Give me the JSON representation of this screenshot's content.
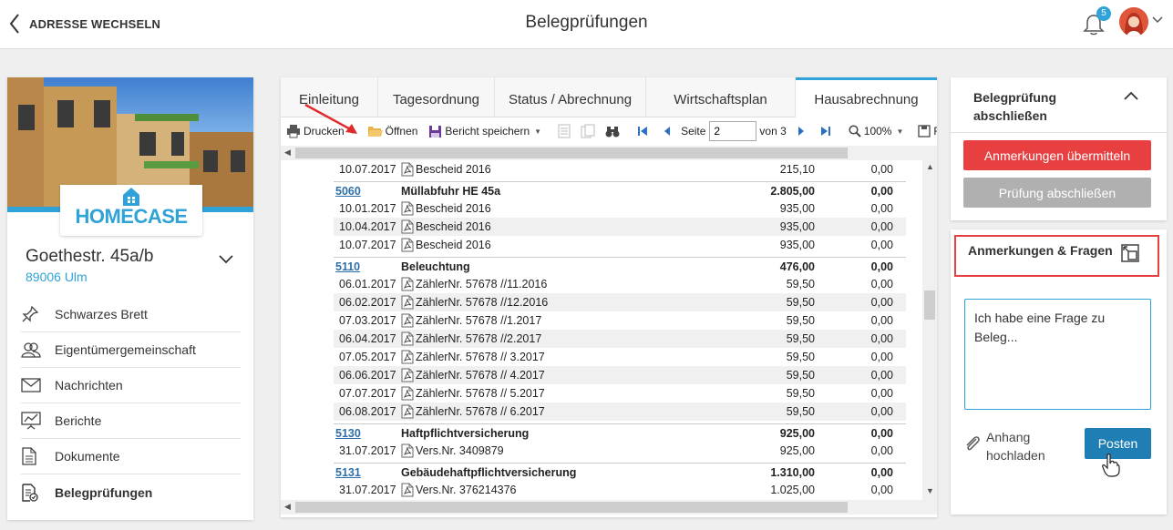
{
  "header": {
    "back_label": "ADRESSE WECHSELN",
    "title": "Belegprüfungen",
    "notification_count": "5"
  },
  "property": {
    "logo_text": "HOMECASE",
    "address": "Goethestr. 45a/b",
    "city": "89006 Ulm"
  },
  "nav": [
    {
      "label": "Schwarzes Brett",
      "icon": "pin-icon"
    },
    {
      "label": "Eigentümergemeinschaft",
      "icon": "users-icon"
    },
    {
      "label": "Nachrichten",
      "icon": "envelope-icon"
    },
    {
      "label": "Berichte",
      "icon": "chart-icon"
    },
    {
      "label": "Dokumente",
      "icon": "document-icon"
    },
    {
      "label": "Belegprüfungen",
      "icon": "receipt-check-icon",
      "active": true
    }
  ],
  "tabs": [
    "Einleitung",
    "Tagesordnung",
    "Status / Abrechnung",
    "Wirtschaftsplan",
    "Hausabrechnung"
  ],
  "active_tab": "Hausabrechnung",
  "toolbar": {
    "print": "Drucken",
    "open": "Öffnen",
    "save_report": "Bericht speichern",
    "page_label": "Seite",
    "page_value": "2",
    "page_of": "von 3",
    "zoom": "100%",
    "cut_label": "Fo"
  },
  "report_rows": [
    {
      "type": "item",
      "date": "10.07.2017",
      "desc": "Bescheid 2016",
      "amount": "215,10",
      "open": "0,00"
    },
    {
      "type": "group",
      "code": "5060",
      "desc": "Müllabfuhr HE 45a",
      "amount": "2.805,00",
      "open": "0,00"
    },
    {
      "type": "item",
      "date": "10.01.2017",
      "desc": "Bescheid 2016",
      "amount": "935,00",
      "open": "0,00"
    },
    {
      "type": "item",
      "date": "10.04.2017",
      "desc": "Bescheid 2016",
      "amount": "935,00",
      "open": "0,00"
    },
    {
      "type": "item",
      "date": "10.07.2017",
      "desc": "Bescheid 2016",
      "amount": "935,00",
      "open": "0,00"
    },
    {
      "type": "group",
      "code": "5110",
      "desc": "Beleuchtung",
      "amount": "476,00",
      "open": "0,00"
    },
    {
      "type": "item",
      "date": "06.01.2017",
      "desc": "ZählerNr. 57678 //11.2016",
      "amount": "59,50",
      "open": "0,00"
    },
    {
      "type": "item",
      "date": "06.02.2017",
      "desc": "ZählerNr. 57678 //12.2016",
      "amount": "59,50",
      "open": "0,00"
    },
    {
      "type": "item",
      "date": "07.03.2017",
      "desc": "ZählerNr. 57678 //1.2017",
      "amount": "59,50",
      "open": "0,00"
    },
    {
      "type": "item",
      "date": "06.04.2017",
      "desc": "ZählerNr. 57678 //2.2017",
      "amount": "59,50",
      "open": "0,00"
    },
    {
      "type": "item",
      "date": "07.05.2017",
      "desc": "ZählerNr. 57678 // 3.2017",
      "amount": "59,50",
      "open": "0,00"
    },
    {
      "type": "item",
      "date": "06.06.2017",
      "desc": "ZählerNr. 57678 // 4.2017",
      "amount": "59,50",
      "open": "0,00"
    },
    {
      "type": "item",
      "date": "07.07.2017",
      "desc": "ZählerNr. 57678 // 5.2017",
      "amount": "59,50",
      "open": "0,00"
    },
    {
      "type": "item",
      "date": "06.08.2017",
      "desc": "ZählerNr. 57678 // 6.2017",
      "amount": "59,50",
      "open": "0,00"
    },
    {
      "type": "group",
      "code": "5130",
      "desc": "Haftpflichtversicherung",
      "amount": "925,00",
      "open": "0,00"
    },
    {
      "type": "item",
      "date": "31.07.2017",
      "desc": "Vers.Nr. 3409879",
      "amount": "925,00",
      "open": "0,00"
    },
    {
      "type": "group",
      "code": "5131",
      "desc": "Gebäudehaftpflichtversicherung",
      "amount": "1.310,00",
      "open": "0,00"
    },
    {
      "type": "item",
      "date": "31.07.2017",
      "desc": "Vers.Nr. 376214376",
      "amount": "1.025,00",
      "open": "0,00"
    }
  ],
  "close_panel": {
    "title": "Belegprüfung abschließen",
    "btn_send": "Anmerkungen übermitteln",
    "btn_finish": "Prüfung abschließen"
  },
  "notes_panel": {
    "title": "Anmerkungen & Fragen",
    "text": "Ich habe eine Frage zu Beleg...",
    "attach_label": "Anhang hochladen",
    "post_label": "Posten"
  },
  "colors": {
    "accent": "#2fa3d8",
    "danger": "#e84040",
    "post": "#1f7fb5"
  }
}
